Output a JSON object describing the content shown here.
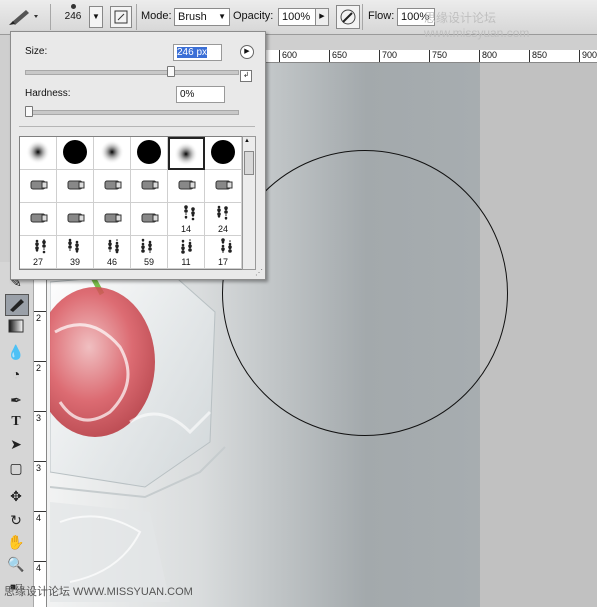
{
  "options_bar": {
    "brush_size": "246",
    "mode_label": "Mode:",
    "mode_value": "Brush",
    "opacity_label": "Opacity:",
    "opacity_value": "100%",
    "flow_label": "Flow:",
    "flow_value": "100%",
    "watermark": "思缘设计论坛  www.missyuan.com"
  },
  "ruler_top": [
    "600",
    "650",
    "700",
    "750",
    "800",
    "850",
    "900"
  ],
  "ruler_left": [
    "2",
    "2",
    "3",
    "3",
    "4",
    "4",
    "5",
    "5"
  ],
  "brush_panel": {
    "size_label": "Size:",
    "size_value": "246 px",
    "size_slider_fraction": 0.69,
    "hardness_label": "Hardness:",
    "hardness_value": "0%",
    "hardness_slider_fraction": 0.0,
    "brushes": [
      {
        "type": "soft"
      },
      {
        "type": "hard"
      },
      {
        "type": "soft"
      },
      {
        "type": "hard"
      },
      {
        "type": "soft",
        "selected": true
      },
      {
        "type": "hard"
      },
      {
        "type": "tip"
      },
      {
        "type": "tip"
      },
      {
        "type": "tip"
      },
      {
        "type": "tip"
      },
      {
        "type": "tip"
      },
      {
        "type": "tip"
      },
      {
        "type": "tip"
      },
      {
        "type": "tip"
      },
      {
        "type": "tip"
      },
      {
        "type": "tip"
      },
      {
        "type": "splat",
        "num": "14"
      },
      {
        "type": "splat",
        "num": "24"
      },
      {
        "type": "splat",
        "num": "27"
      },
      {
        "type": "splat",
        "num": "39"
      },
      {
        "type": "splat",
        "num": "46"
      },
      {
        "type": "splat",
        "num": "59"
      },
      {
        "type": "splat",
        "num": "11"
      },
      {
        "type": "splat",
        "num": "17"
      }
    ]
  },
  "bottom_watermark": "思缘设计论坛  WWW.MISSYUAN.COM"
}
